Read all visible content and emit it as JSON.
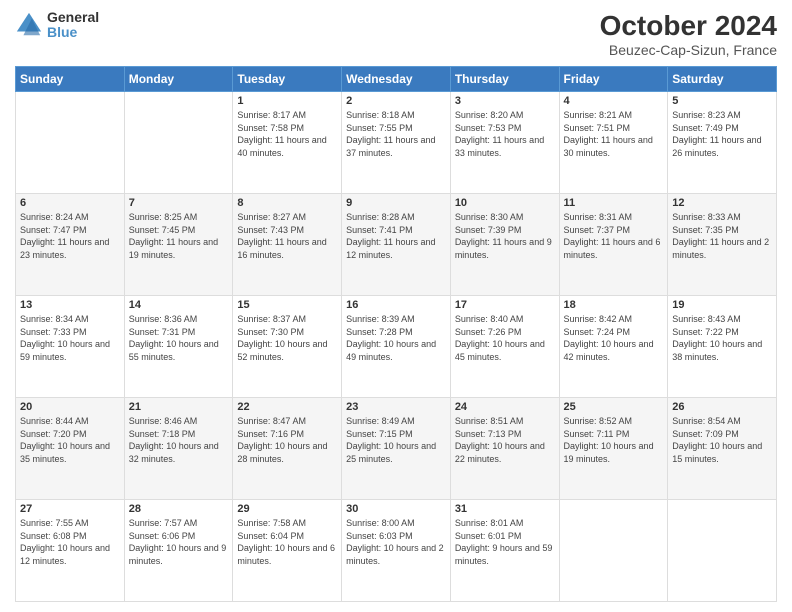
{
  "header": {
    "logo_line1": "General",
    "logo_line2": "Blue",
    "title": "October 2024",
    "subtitle": "Beuzec-Cap-Sizun, France"
  },
  "days_of_week": [
    "Sunday",
    "Monday",
    "Tuesday",
    "Wednesday",
    "Thursday",
    "Friday",
    "Saturday"
  ],
  "weeks": [
    [
      {
        "day": "",
        "info": ""
      },
      {
        "day": "",
        "info": ""
      },
      {
        "day": "1",
        "info": "Sunrise: 8:17 AM\nSunset: 7:58 PM\nDaylight: 11 hours and 40 minutes."
      },
      {
        "day": "2",
        "info": "Sunrise: 8:18 AM\nSunset: 7:55 PM\nDaylight: 11 hours and 37 minutes."
      },
      {
        "day": "3",
        "info": "Sunrise: 8:20 AM\nSunset: 7:53 PM\nDaylight: 11 hours and 33 minutes."
      },
      {
        "day": "4",
        "info": "Sunrise: 8:21 AM\nSunset: 7:51 PM\nDaylight: 11 hours and 30 minutes."
      },
      {
        "day": "5",
        "info": "Sunrise: 8:23 AM\nSunset: 7:49 PM\nDaylight: 11 hours and 26 minutes."
      }
    ],
    [
      {
        "day": "6",
        "info": "Sunrise: 8:24 AM\nSunset: 7:47 PM\nDaylight: 11 hours and 23 minutes."
      },
      {
        "day": "7",
        "info": "Sunrise: 8:25 AM\nSunset: 7:45 PM\nDaylight: 11 hours and 19 minutes."
      },
      {
        "day": "8",
        "info": "Sunrise: 8:27 AM\nSunset: 7:43 PM\nDaylight: 11 hours and 16 minutes."
      },
      {
        "day": "9",
        "info": "Sunrise: 8:28 AM\nSunset: 7:41 PM\nDaylight: 11 hours and 12 minutes."
      },
      {
        "day": "10",
        "info": "Sunrise: 8:30 AM\nSunset: 7:39 PM\nDaylight: 11 hours and 9 minutes."
      },
      {
        "day": "11",
        "info": "Sunrise: 8:31 AM\nSunset: 7:37 PM\nDaylight: 11 hours and 6 minutes."
      },
      {
        "day": "12",
        "info": "Sunrise: 8:33 AM\nSunset: 7:35 PM\nDaylight: 11 hours and 2 minutes."
      }
    ],
    [
      {
        "day": "13",
        "info": "Sunrise: 8:34 AM\nSunset: 7:33 PM\nDaylight: 10 hours and 59 minutes."
      },
      {
        "day": "14",
        "info": "Sunrise: 8:36 AM\nSunset: 7:31 PM\nDaylight: 10 hours and 55 minutes."
      },
      {
        "day": "15",
        "info": "Sunrise: 8:37 AM\nSunset: 7:30 PM\nDaylight: 10 hours and 52 minutes."
      },
      {
        "day": "16",
        "info": "Sunrise: 8:39 AM\nSunset: 7:28 PM\nDaylight: 10 hours and 49 minutes."
      },
      {
        "day": "17",
        "info": "Sunrise: 8:40 AM\nSunset: 7:26 PM\nDaylight: 10 hours and 45 minutes."
      },
      {
        "day": "18",
        "info": "Sunrise: 8:42 AM\nSunset: 7:24 PM\nDaylight: 10 hours and 42 minutes."
      },
      {
        "day": "19",
        "info": "Sunrise: 8:43 AM\nSunset: 7:22 PM\nDaylight: 10 hours and 38 minutes."
      }
    ],
    [
      {
        "day": "20",
        "info": "Sunrise: 8:44 AM\nSunset: 7:20 PM\nDaylight: 10 hours and 35 minutes."
      },
      {
        "day": "21",
        "info": "Sunrise: 8:46 AM\nSunset: 7:18 PM\nDaylight: 10 hours and 32 minutes."
      },
      {
        "day": "22",
        "info": "Sunrise: 8:47 AM\nSunset: 7:16 PM\nDaylight: 10 hours and 28 minutes."
      },
      {
        "day": "23",
        "info": "Sunrise: 8:49 AM\nSunset: 7:15 PM\nDaylight: 10 hours and 25 minutes."
      },
      {
        "day": "24",
        "info": "Sunrise: 8:51 AM\nSunset: 7:13 PM\nDaylight: 10 hours and 22 minutes."
      },
      {
        "day": "25",
        "info": "Sunrise: 8:52 AM\nSunset: 7:11 PM\nDaylight: 10 hours and 19 minutes."
      },
      {
        "day": "26",
        "info": "Sunrise: 8:54 AM\nSunset: 7:09 PM\nDaylight: 10 hours and 15 minutes."
      }
    ],
    [
      {
        "day": "27",
        "info": "Sunrise: 7:55 AM\nSunset: 6:08 PM\nDaylight: 10 hours and 12 minutes."
      },
      {
        "day": "28",
        "info": "Sunrise: 7:57 AM\nSunset: 6:06 PM\nDaylight: 10 hours and 9 minutes."
      },
      {
        "day": "29",
        "info": "Sunrise: 7:58 AM\nSunset: 6:04 PM\nDaylight: 10 hours and 6 minutes."
      },
      {
        "day": "30",
        "info": "Sunrise: 8:00 AM\nSunset: 6:03 PM\nDaylight: 10 hours and 2 minutes."
      },
      {
        "day": "31",
        "info": "Sunrise: 8:01 AM\nSunset: 6:01 PM\nDaylight: 9 hours and 59 minutes."
      },
      {
        "day": "",
        "info": ""
      },
      {
        "day": "",
        "info": ""
      }
    ]
  ]
}
